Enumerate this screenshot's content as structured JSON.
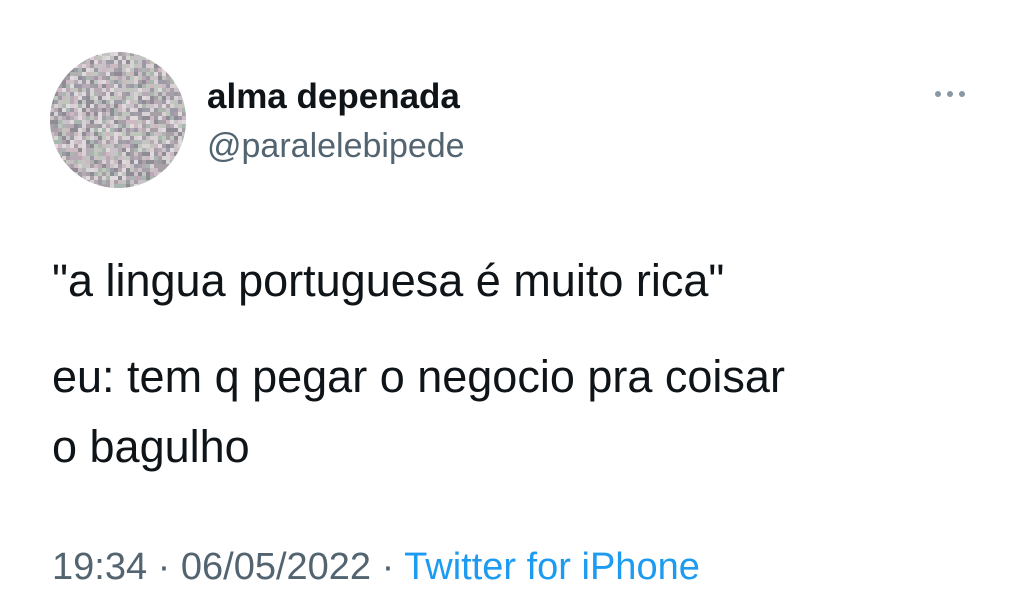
{
  "tweet": {
    "author": {
      "display_name": "alma depenada",
      "handle": "@paralelebipede"
    },
    "more_icon": "more-horizontal-icon",
    "text_lines": [
      "\"a lingua portuguesa é muito rica\"",
      "eu: tem q pegar o negocio pra coisar",
      "o bagulho"
    ],
    "time": "19:34",
    "separator": "·",
    "date": "06/05/2022",
    "source": "Twitter for iPhone",
    "colors": {
      "text": "#0f1419",
      "secondary": "#536471",
      "link": "#1d9bf0"
    }
  }
}
